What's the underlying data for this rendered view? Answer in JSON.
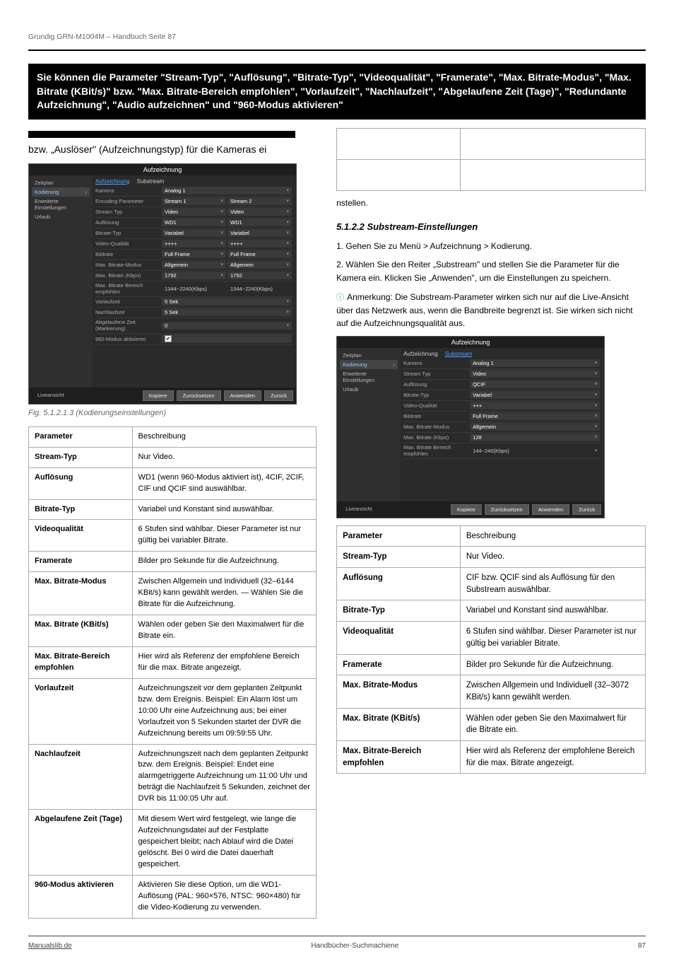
{
  "header": {
    "text": "Grundig GRN-M1004M – Handbuch Seite 87"
  },
  "blackbar": "Sie können die Parameter \"Stream-Typ\", \"Auflösung\", \"Bitrate-Typ\", \"Videoqualität\", \"Framerate\", \"Max. Bitrate-Modus\", \"Max. Bitrate (KBit/s)\" bzw. \"Max. Bitrate-Bereich empfohlen\", \"Vorlaufzeit\", \"Nachlaufzeit\", \"Abgelaufene Zeit (Tage)\", \"Redundante Aufzeichnung\", \"Audio aufzeichnen\" und \"960-Modus aktivieren\"",
  "snippet_left": "bzw. „Auslöser\" (Aufzeichnungstyp) für die Kameras ei",
  "fig1": {
    "title": "Aufzeichnung",
    "sidebar": [
      "Zeitplan",
      "Kodierung",
      "Erweiterte Einstellungen",
      "Urlaub"
    ],
    "sidebar_sel": 1,
    "tabs": [
      "Aufzeichnung",
      "Substream"
    ],
    "tab_on": 0,
    "rows": [
      {
        "l": "Kamera",
        "c": [
          "Analog 1"
        ]
      },
      {
        "l": "Encoding Parameter",
        "c": [
          "Stream 1",
          "Stream 2"
        ]
      },
      {
        "l": "Stream Typ",
        "c": [
          "Video",
          "Video"
        ]
      },
      {
        "l": "Auflösung",
        "c": [
          "WD1",
          "WD1"
        ]
      },
      {
        "l": "Bitrate-Typ",
        "c": [
          "Variabel",
          "Variabel"
        ]
      },
      {
        "l": "Video-Qualität",
        "c": [
          "++++",
          "++++"
        ]
      },
      {
        "l": "Bildrate",
        "c": [
          "Full Frame",
          "Full Frame"
        ]
      },
      {
        "l": "Max. Bitrate-Modus",
        "c": [
          "Allgemein",
          "Allgemein"
        ]
      },
      {
        "l": "Max. Bitrate (Kbps)",
        "c": [
          "1792",
          "1792"
        ]
      },
      {
        "l": "Max. Bitrate Bereich empfohlen",
        "c": [
          "1344~2240(Kbps)",
          "1344~2240(Kbps)"
        ],
        "ro": true
      },
      {
        "l": "Vorlaufzeit",
        "c": [
          "5 Sek"
        ]
      },
      {
        "l": "Nachlaufzeit",
        "c": [
          "5 Sek"
        ]
      },
      {
        "l": "Abgelaufene Zeit (Markierung)",
        "c": [
          "0"
        ]
      },
      {
        "l": "960-Modus aktivieren",
        "c": [
          "☑"
        ],
        "chk": true
      }
    ],
    "buttons": [
      "Kopiere",
      "Zurücksetzen",
      "Anwenden",
      "Zurück"
    ],
    "live": "Liveansicht"
  },
  "fig1_label": "Fig. 5.1.2.1.3 (Kodierungseinstellungen)",
  "fig2": {
    "title": "Aufzeichnung",
    "sidebar": [
      "Zeitplan",
      "Kodierung",
      "Erweiterte Einstellungen",
      "Urlaub"
    ],
    "sidebar_sel": 1,
    "tabs": [
      "Aufzeichnung",
      "Substream"
    ],
    "tab_on": 1,
    "rows": [
      {
        "l": "Kamera",
        "c": [
          "Analog 1"
        ]
      },
      {
        "l": "Stream Typ",
        "c": [
          "Video"
        ]
      },
      {
        "l": "Auflösung",
        "c": [
          "QCIF"
        ]
      },
      {
        "l": "Bitrate-Typ",
        "c": [
          "Variabel"
        ]
      },
      {
        "l": "Video-Qualität",
        "c": [
          "+++"
        ]
      },
      {
        "l": "Bildrate",
        "c": [
          "Full Frame"
        ]
      },
      {
        "l": "Max. Bitrate-Modus",
        "c": [
          "Allgemein"
        ]
      },
      {
        "l": "Max. Bitrate (Kbps)",
        "c": [
          "128"
        ]
      },
      {
        "l": "Max. Bitrate Bereich empfohlen",
        "c": [
          "144~240(Kbps)"
        ],
        "ro": true
      }
    ],
    "buttons": [
      "Kopiere",
      "Zurücksetzen",
      "Anwenden",
      "Zurück"
    ],
    "live": "Liveansicht"
  },
  "right_intro": "nstellen.",
  "right_substream_heading": "5.1.2.2 Substream-Einstellungen",
  "right_substream_1": "1. Gehen Sie zu Menü > Aufzeichnung > Kodierung.",
  "right_substream_2": "2. Wählen Sie den Reiter „Substream\" und stellen Sie die Parameter für die Kamera ein. Klicken Sie „Anwenden\", um die Einstellungen zu speichern.",
  "right_note": "Anmerkung: Die Substream-Parameter wirken sich nur auf die Live-Ansicht über das Netzwerk aus, wenn die Bandbreite begrenzt ist. Sie wirken sich nicht auf die Aufzeichnungsqualität aus.",
  "right_mini_table": [
    [
      "Parameter",
      "Beschreibung"
    ],
    [
      "Stream-Typ",
      "Nur Video."
    ],
    [
      "Auflösung",
      "CIF bzw. QCIF sind als Auflösung für den Substream auswählbar."
    ],
    [
      "Bitrate-Typ",
      "Variabel und Konstant sind auswählbar."
    ],
    [
      "Videoqualität",
      "6 Stufen sind wählbar. Dieser Parameter ist nur gültig bei variabler Bitrate."
    ],
    [
      "Framerate",
      "Bilder pro Sekunde für die Aufzeichnung."
    ],
    [
      "Max. Bitrate-Modus",
      "Zwischen Allgemein und Individuell (32–3072 KBit/s) kann gewählt werden."
    ],
    [
      "Max. Bitrate (KBit/s)",
      "Wählen oder geben Sie den Maximalwert für die Bitrate ein."
    ],
    [
      "Max. Bitrate-Bereich empfohlen",
      "Hier wird als Referenz der empfohlene Bereich für die max. Bitrate angezeigt."
    ]
  ],
  "left_mini_table": [
    [
      "Parameter",
      "Beschreibung"
    ],
    [
      "Stream-Typ",
      "Nur Video."
    ],
    [
      "Auflösung",
      "WD1 (wenn 960-Modus aktiviert ist), 4CIF, 2CIF, CIF und QCIF sind auswählbar."
    ],
    [
      "Bitrate-Typ",
      "Variabel und Konstant sind auswählbar."
    ],
    [
      "Videoqualität",
      "6 Stufen sind wählbar. Dieser Parameter ist nur gültig bei variabler Bitrate."
    ],
    [
      "Framerate",
      "Bilder pro Sekunde für die Aufzeichnung."
    ],
    [
      "Max. Bitrate-Modus",
      "Zwischen Allgemein und Individuell (32–6144 KBit/s) kann gewählt werden. — Wählen Sie die Bitrate für die Aufzeichnung."
    ],
    [
      "Max. Bitrate (KBit/s)",
      "Wählen oder geben Sie den Maximalwert für die Bitrate ein."
    ],
    [
      "Max. Bitrate-Bereich empfohlen",
      "Hier wird als Referenz der empfohlene Bereich für die max. Bitrate angezeigt."
    ],
    [
      "Vorlaufzeit",
      "Aufzeichnungszeit vor dem geplanten Zeitpunkt bzw. dem Ereignis. Beispiel: Ein Alarm löst um 10:00 Uhr eine Aufzeichnung aus; bei einer Vorlaufzeit von 5 Sekunden startet der DVR die Aufzeichnung bereits um 09:59:55 Uhr."
    ],
    [
      "Nachlaufzeit",
      "Aufzeichnungszeit nach dem geplanten Zeitpunkt bzw. dem Ereignis. Beispiel: Endet eine alarmgetriggerte Aufzeichnung um 11:00 Uhr und beträgt die Nachlaufzeit 5 Sekunden, zeichnet der DVR bis 11:00:05 Uhr auf."
    ],
    [
      "Abgelaufene Zeit (Tage)",
      "Mit diesem Wert wird festgelegt, wie lange die Aufzeichnungsdatei auf der Festplatte gespeichert bleibt; nach Ablauf wird die Datei gelöscht. Bei 0 wird die Datei dauerhaft gespeichert."
    ],
    [
      "960-Modus aktivieren",
      "Aktivieren Sie diese Option, um die WD1-Auflösung (PAL: 960×576, NTSC: 960×480) für die Video-Kodierung zu verwenden."
    ]
  ],
  "footer": {
    "left": "Manualslib.de",
    "mid": "Handbücher-Suchmachiene",
    "right": "87"
  }
}
